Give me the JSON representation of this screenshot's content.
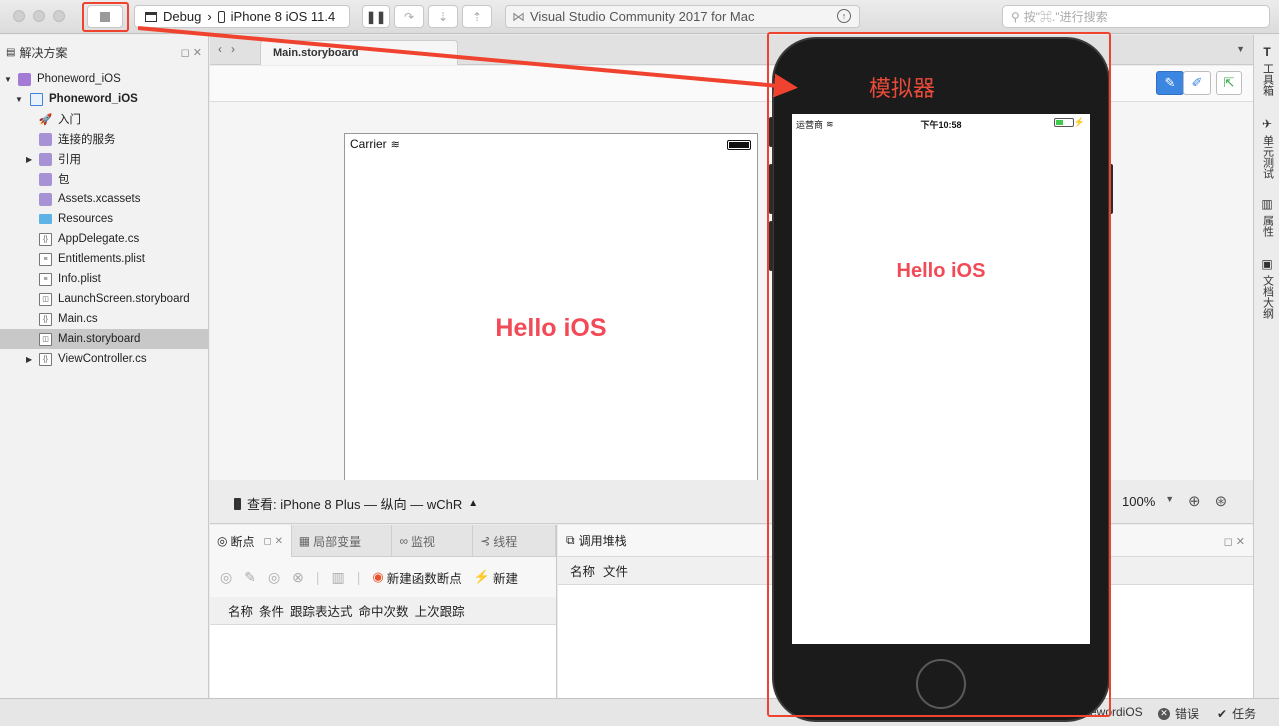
{
  "toolbar": {
    "configuration": "Debug",
    "device": "iPhone 8 iOS 11.4",
    "status_text": "Visual Studio Community 2017 for Mac",
    "search_placeholder": "按\"⌘.\"进行搜索"
  },
  "solution_pad": {
    "title": "解决方案",
    "items": [
      {
        "label": "Phoneword_iOS",
        "icon": "solution-icon"
      },
      {
        "label": "Phoneword_iOS",
        "icon": "project-icon"
      },
      {
        "label": "入门",
        "icon": "rocket-icon"
      },
      {
        "label": "连接的服务",
        "icon": "services-icon"
      },
      {
        "label": "引用",
        "icon": "references-icon"
      },
      {
        "label": "包",
        "icon": "packages-icon"
      },
      {
        "label": "Assets.xcassets",
        "icon": "assets-icon"
      },
      {
        "label": "Resources",
        "icon": "folder-icon"
      },
      {
        "label": "AppDelegate.cs",
        "icon": "cs-file-icon"
      },
      {
        "label": "Entitlements.plist",
        "icon": "plist-file-icon"
      },
      {
        "label": "Info.plist",
        "icon": "plist-file-icon"
      },
      {
        "label": "LaunchScreen.storyboard",
        "icon": "storyboard-file-icon"
      },
      {
        "label": "Main.cs",
        "icon": "cs-file-icon"
      },
      {
        "label": "Main.storyboard",
        "icon": "storyboard-file-icon"
      },
      {
        "label": "ViewController.cs",
        "icon": "cs-file-icon"
      }
    ]
  },
  "editor": {
    "tab_label": "Main.storyboard",
    "canvas_carrier": "Carrier",
    "canvas_hello": "Hello iOS",
    "view_label": "查看: iPhone 8 Plus — 纵向 — wChR",
    "zoom": "100%"
  },
  "breakpoints_pad": {
    "tabs": [
      "断点",
      "局部变量",
      "监视",
      "线程"
    ],
    "new_function_breakpoint": "新建函数断点",
    "new_exception_catchpoint": "新建异",
    "columns": [
      "名称",
      "条件",
      "跟踪表达式",
      "命中次数",
      "上次跟踪"
    ]
  },
  "call_stack_pad": {
    "title": "调用堆栈",
    "columns": [
      "名称",
      "文件"
    ]
  },
  "right_dock": {
    "items": [
      "工具箱",
      "单元测试",
      "属性",
      "文档大纲"
    ]
  },
  "status_bar": {
    "project_fragment": "ewordiOS",
    "errors": "错误",
    "tasks": "任务"
  },
  "simulator": {
    "annotation": "模拟器",
    "carrier": "运营商",
    "time": "下午10:58",
    "hello": "Hello iOS"
  },
  "colors": {
    "annotation_red": "#f0432f",
    "hello_text": "#f24a56",
    "accent_blue": "#3f84d8"
  }
}
